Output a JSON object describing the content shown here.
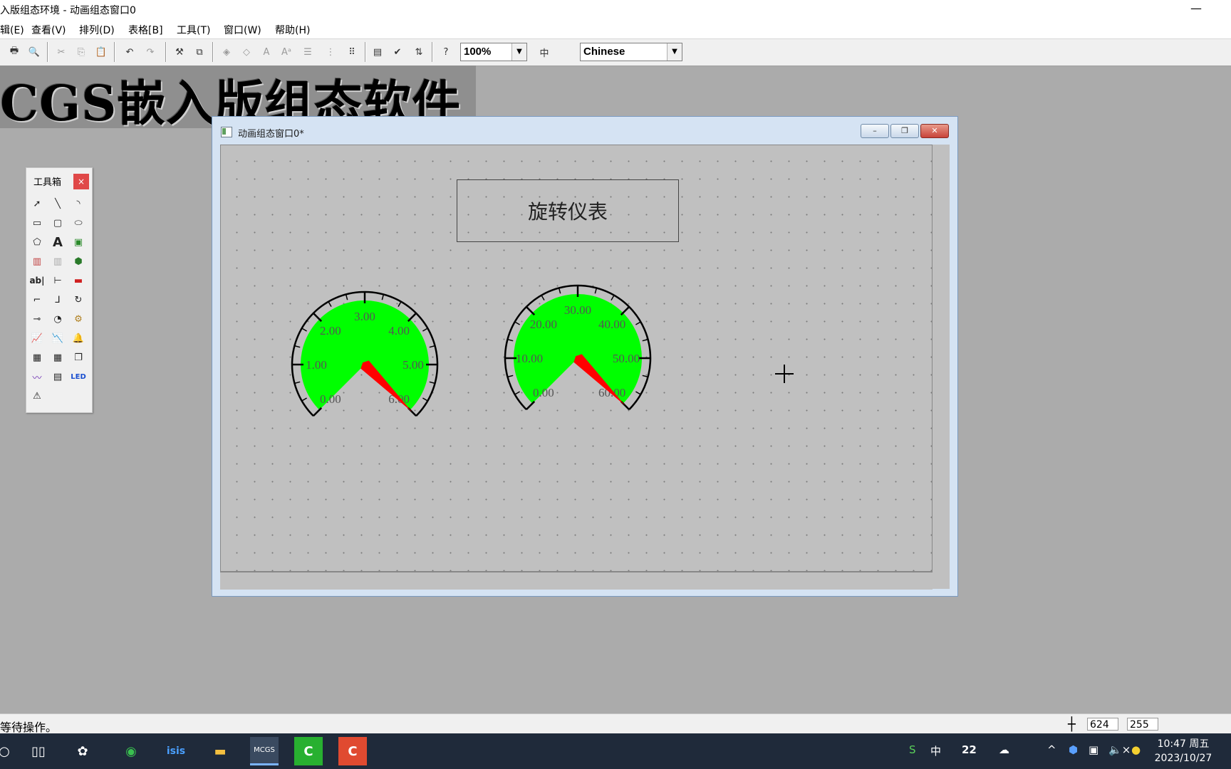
{
  "window": {
    "title": "入版组态环境 - 动画组态窗口0",
    "minimize_glyph": "—"
  },
  "menu": [
    "辑(E)",
    "查看(V)",
    "排列(D)",
    "表格[B]",
    "工具(T)",
    "窗口(W)",
    "帮助(H)"
  ],
  "toolbar": {
    "zoom_value": "100%",
    "language_value": "Chinese"
  },
  "banner": {
    "text": "CGS嵌入版组态软件"
  },
  "toolbox": {
    "title": "工具箱",
    "close": "×"
  },
  "child_window": {
    "title": "动画组态窗口0*"
  },
  "label_box": {
    "text": "旋转仪表"
  },
  "gauge1": {
    "ticks": [
      "0.00",
      "1.00",
      "2.00",
      "3.00",
      "4.00",
      "5.00",
      "6.00"
    ],
    "min": 0,
    "max": 6,
    "needle_value": 6.0,
    "fill_color": "#00ff00",
    "needle_color": "#ff0000"
  },
  "gauge2": {
    "ticks": [
      "0.00",
      "10.00",
      "20.00",
      "30.00",
      "40.00",
      "50.00",
      "60.00"
    ],
    "min": 0,
    "max": 60,
    "needle_value": 60.0,
    "fill_color": "#00ff00",
    "needle_color": "#ff0000"
  },
  "status": {
    "message": "等待操作。",
    "coord_x": "624",
    "coord_y": "255"
  },
  "taskbar": {
    "clock_time": "10:47 周五",
    "clock_date": "2023/10/27",
    "app_mcgs_label": "MCGS",
    "app_isis_label": "isis",
    "tray_input_label": "中",
    "tray_weather": "22",
    "tray_mute": "×"
  }
}
